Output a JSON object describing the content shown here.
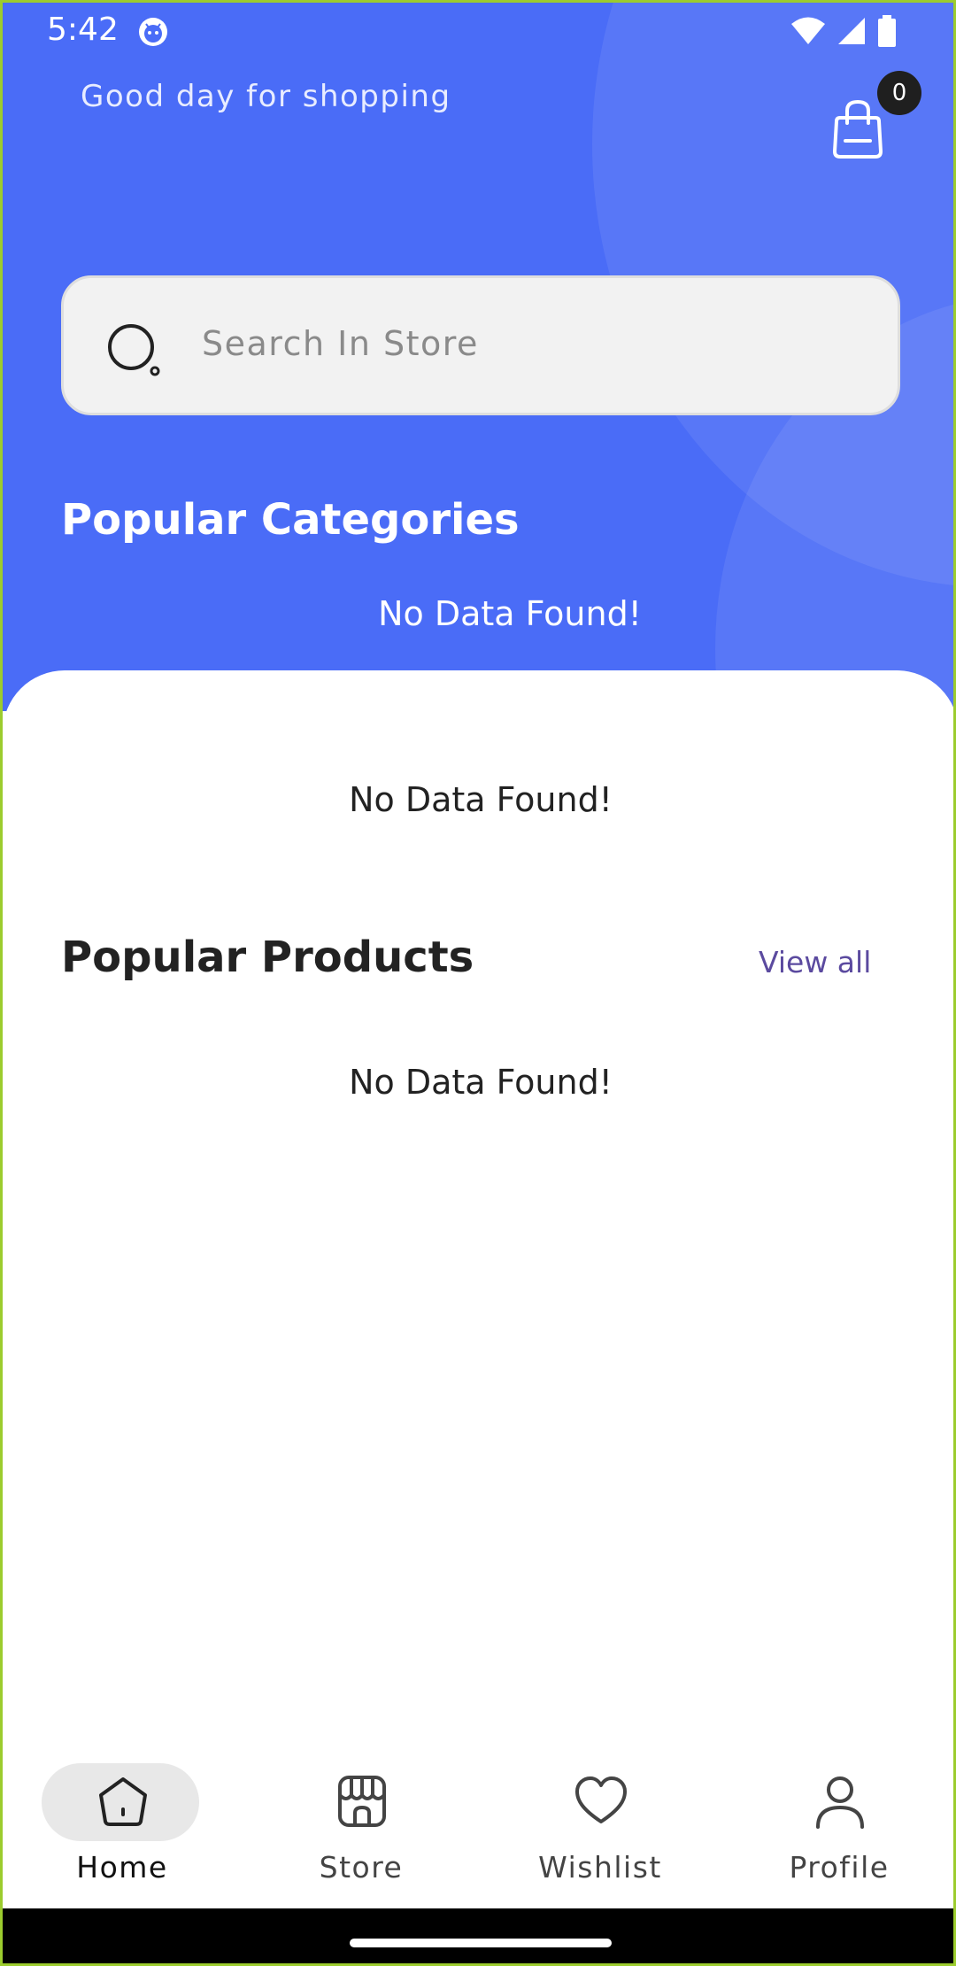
{
  "status_bar": {
    "time": "5:42",
    "app_icon": "android-head-icon",
    "icons": [
      "wifi-icon",
      "signal-icon",
      "battery-icon"
    ]
  },
  "header": {
    "greeting": "Good day for shopping",
    "cart_count": "0",
    "cart_icon": "shopping-bag-icon"
  },
  "search": {
    "placeholder": "Search In Store",
    "icon": "search-icon"
  },
  "categories": {
    "title": "Popular Categories",
    "empty_message": "No Data Found!"
  },
  "banner": {
    "empty_message": "No Data Found!"
  },
  "products": {
    "title": "Popular Products",
    "view_all_label": "View all",
    "empty_message": "No Data Found!"
  },
  "bottom_nav": {
    "items": [
      {
        "label": "Home",
        "icon": "home-icon",
        "active": true
      },
      {
        "label": "Store",
        "icon": "store-icon",
        "active": false
      },
      {
        "label": "Wishlist",
        "icon": "heart-icon",
        "active": false
      },
      {
        "label": "Profile",
        "icon": "user-icon",
        "active": false
      }
    ]
  },
  "colors": {
    "primary": "#4a6cf7",
    "view_all": "#5b4a9f",
    "badge": "#1f1f1f"
  }
}
